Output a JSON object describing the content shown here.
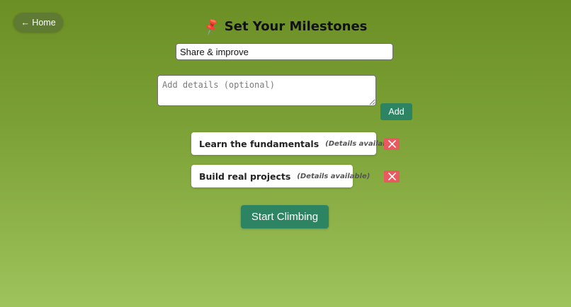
{
  "nav": {
    "home_label": "← Home"
  },
  "header": {
    "title": "Set Your Milestones",
    "icon": "pushpin-icon"
  },
  "form": {
    "title_value": "Share & improve",
    "details_placeholder": "Add details (optional)",
    "add_label": "Add"
  },
  "milestones": [
    {
      "title": "Learn the fundamentals",
      "details_note": "(Details available)"
    },
    {
      "title": "Build real projects",
      "details_note": "(Details available)"
    }
  ],
  "actions": {
    "start_label": "Start Climbing"
  },
  "colors": {
    "primary": "#2c8463",
    "danger": "#e85a5f",
    "home_button": "#5f7a32",
    "background_top": "#6b8f24",
    "background_bottom": "#9fc35c"
  }
}
